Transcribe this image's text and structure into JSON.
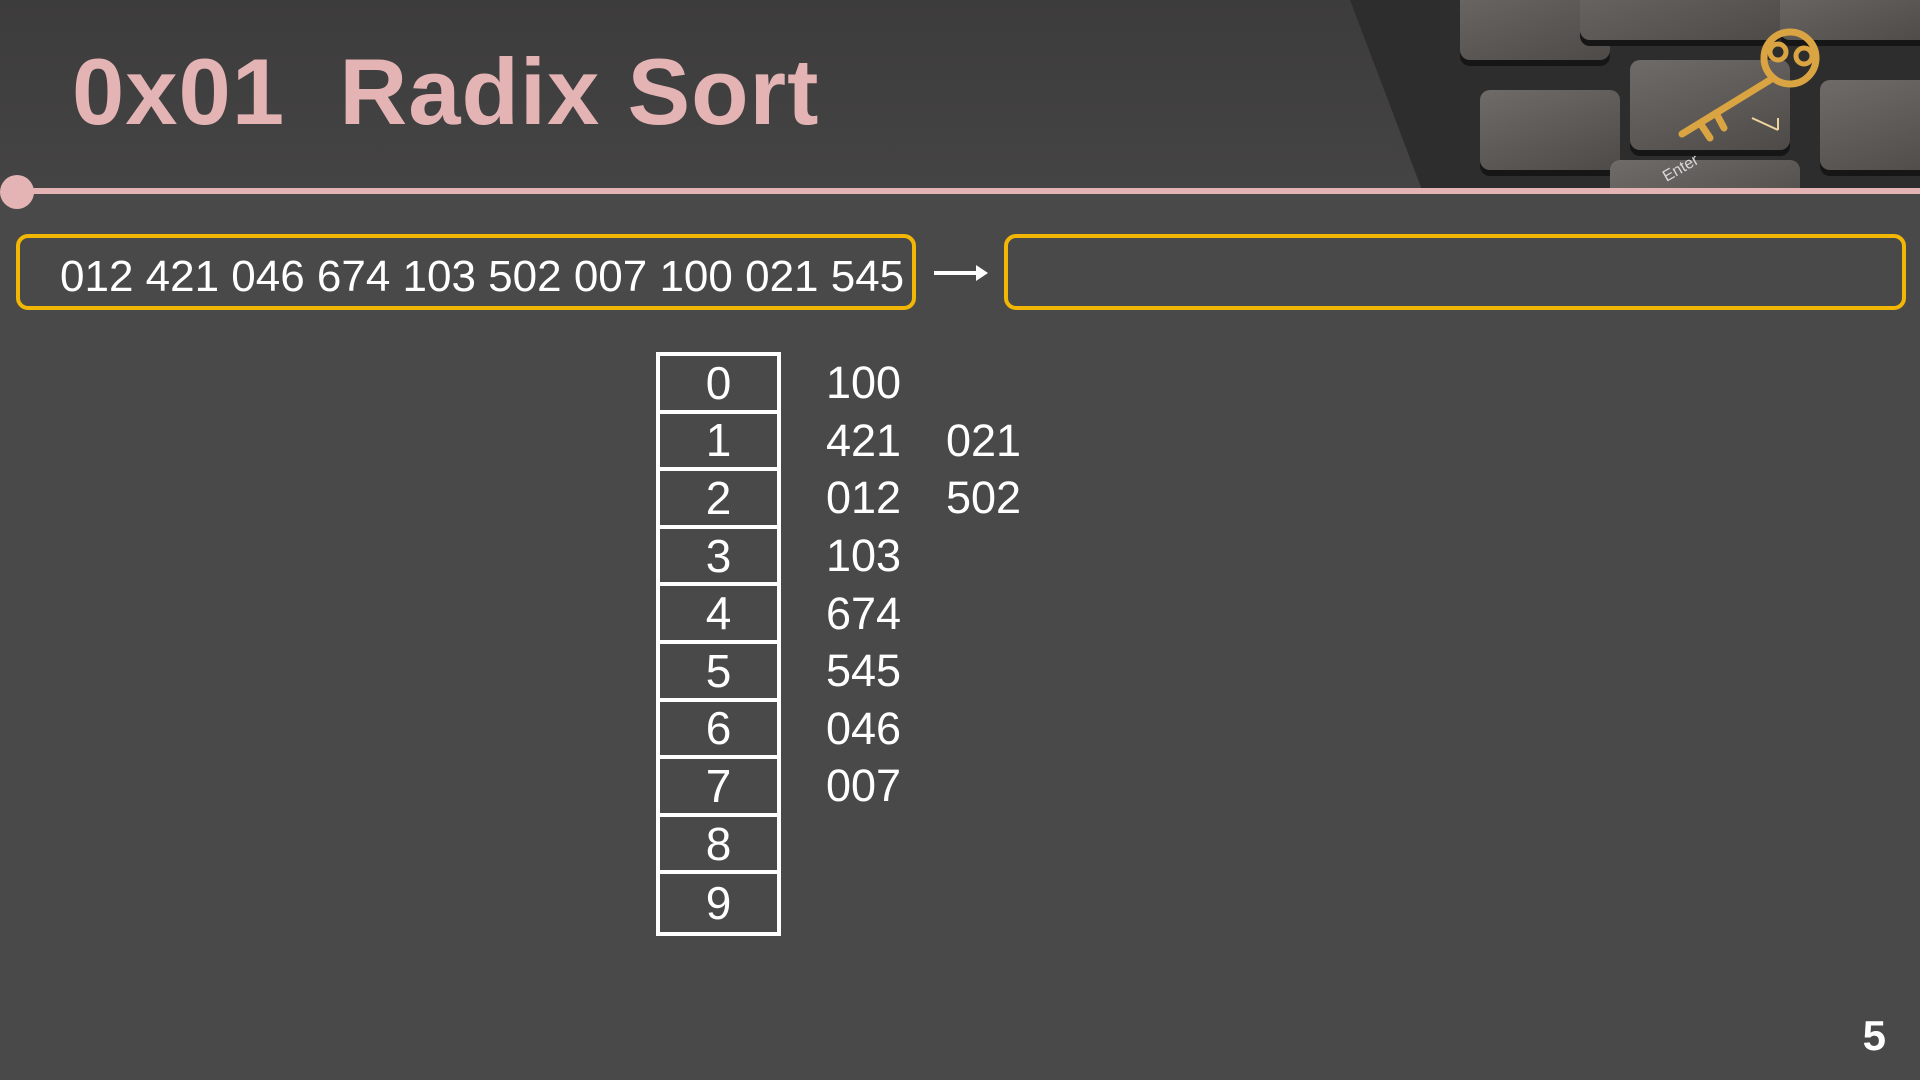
{
  "slide": {
    "title": "0x01  Radix Sort",
    "page_number": "5"
  },
  "photo": {
    "description_icon": "keyboard-key-photo-icon",
    "enter_key_label": "Enter"
  },
  "colors": {
    "title": "#e4b4b4",
    "accent_line": "#e4b4b4",
    "box_border": "#f2b705",
    "background": "#4a4949",
    "text": "#ffffff"
  },
  "input_sequence": "012 421 046 674 103 502 007 100 021 545",
  "output_sequence": "",
  "buckets": [
    {
      "digit": "0",
      "values": [
        "100"
      ]
    },
    {
      "digit": "1",
      "values": [
        "421",
        "021"
      ]
    },
    {
      "digit": "2",
      "values": [
        "012",
        "502"
      ]
    },
    {
      "digit": "3",
      "values": [
        "103"
      ]
    },
    {
      "digit": "4",
      "values": [
        "674"
      ]
    },
    {
      "digit": "5",
      "values": [
        "545"
      ]
    },
    {
      "digit": "6",
      "values": [
        "046"
      ]
    },
    {
      "digit": "7",
      "values": [
        "007"
      ]
    },
    {
      "digit": "8",
      "values": []
    },
    {
      "digit": "9",
      "values": []
    }
  ]
}
